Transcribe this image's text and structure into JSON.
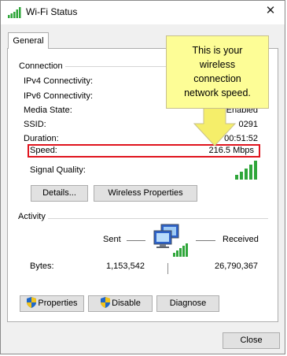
{
  "window": {
    "title": "Wi-Fi Status",
    "close_glyph": "✕"
  },
  "tabs": [
    {
      "label": "General"
    }
  ],
  "connection": {
    "heading": "Connection",
    "rows": [
      {
        "label": "IPv4 Connectivity:",
        "value": ""
      },
      {
        "label": "IPv6 Connectivity:",
        "value": ""
      },
      {
        "label": "Media State:",
        "value": "Enabled"
      },
      {
        "label": "SSID:",
        "value": "0291"
      },
      {
        "label": "Duration:",
        "value": "00:51:52"
      },
      {
        "label": "Speed:",
        "value": "216.5 Mbps"
      }
    ],
    "signal_label": "Signal Quality:",
    "signal_bars": 5,
    "details_button": "Details...",
    "wireless_properties_button": "Wireless Properties"
  },
  "activity": {
    "heading": "Activity",
    "sent_label": "Sent",
    "received_label": "Received",
    "bytes_label": "Bytes:",
    "bytes_sent": "1,153,542",
    "bytes_received": "26,790,367"
  },
  "buttons": {
    "properties": "Properties",
    "disable": "Disable",
    "diagnose": "Diagnose",
    "close": "Close"
  },
  "callout": {
    "lines": [
      "This is your",
      "wireless",
      "connection",
      "network speed."
    ],
    "background": "#fdfd96",
    "arrow_color": "#f5ee6a"
  },
  "colors": {
    "highlight_border": "#e0141e",
    "signal_green": "#2fa63a",
    "shield_blue": "#1f67c8",
    "shield_yellow": "#f2c31b"
  }
}
